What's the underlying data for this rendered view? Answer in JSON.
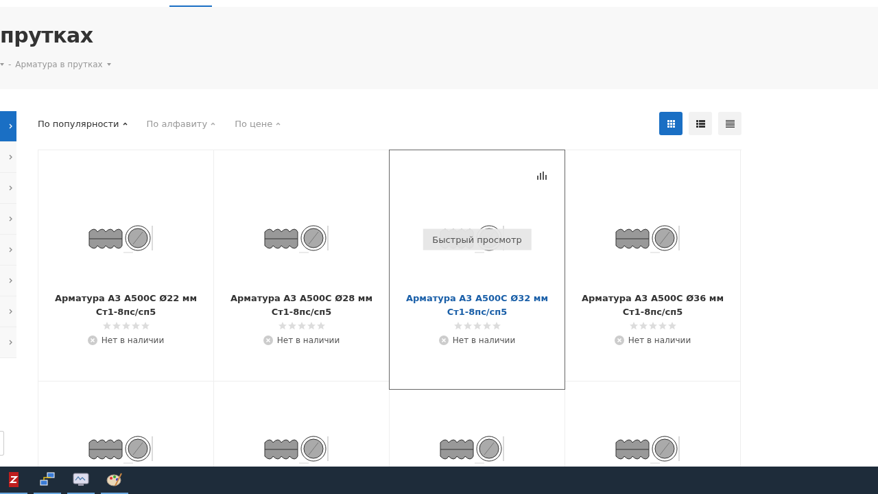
{
  "page_title": "прутках",
  "breadcrumbs": [
    {
      "label": "Арматура в прутках",
      "separator": "-"
    }
  ],
  "sidebar": {
    "items": [
      {
        "selected": true
      },
      {
        "selected": false
      },
      {
        "selected": false
      },
      {
        "selected": false
      },
      {
        "selected": false
      },
      {
        "selected": false
      },
      {
        "selected": false
      },
      {
        "selected": false
      }
    ]
  },
  "sort_options": [
    {
      "label": "По популярности",
      "selected": true
    },
    {
      "label": "По алфавиту",
      "selected": false
    },
    {
      "label": "По цене",
      "selected": false
    }
  ],
  "view_modes": [
    {
      "kind": "grid",
      "selected": true
    },
    {
      "kind": "list",
      "selected": false
    },
    {
      "kind": "table",
      "selected": false
    }
  ],
  "products": [
    {
      "name": "Арматура А3 А500С Ø22 мм Ст1-8пс/сп5",
      "stars": 0,
      "availability": "Нет в наличии",
      "hovered": false
    },
    {
      "name": "Арматура А3 А500С Ø28 мм Ст1-8пс/сп5",
      "stars": 0,
      "availability": "Нет в наличии",
      "hovered": false
    },
    {
      "name": "Арматура А3 А500С Ø32 мм Ст1-8пс/сп5",
      "stars": 0,
      "availability": "Нет в наличии",
      "hovered": true,
      "quick_view": "Быстрый просмотр"
    },
    {
      "name": "Арматура А3 А500С Ø36 мм Ст1-8пс/сп5",
      "stars": 0,
      "availability": "Нет в наличии",
      "hovered": false
    },
    {
      "hovered": false
    },
    {
      "hovered": false
    },
    {
      "hovered": false
    },
    {
      "hovered": false
    }
  ],
  "taskbar": {
    "apps": [
      {
        "kind": "filezilla"
      },
      {
        "kind": "network"
      },
      {
        "kind": "monitor"
      },
      {
        "kind": "paint"
      }
    ]
  }
}
